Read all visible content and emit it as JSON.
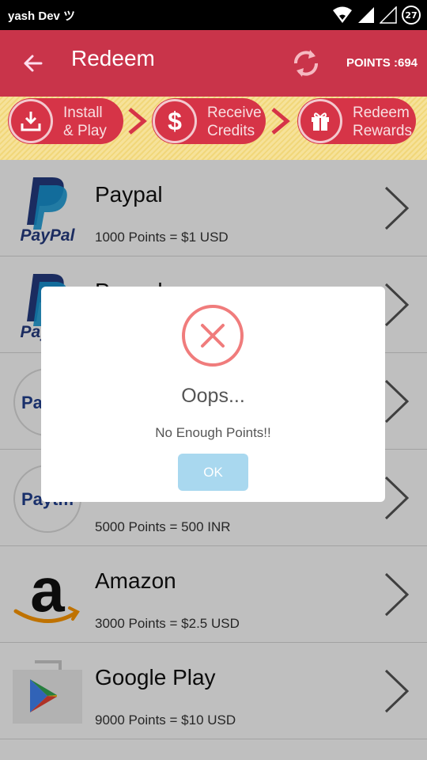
{
  "status_bar": {
    "user": "yash Dev ツ",
    "battery": "27"
  },
  "app_bar": {
    "title": "Redeem",
    "points": "POINTS :694"
  },
  "steps": [
    {
      "line1": "Install",
      "line2": "& Play",
      "icon": "download-icon"
    },
    {
      "line1": "Receive",
      "line2": "Credits",
      "icon": "dollar-icon"
    },
    {
      "line1": "Redeem",
      "line2": "Rewards",
      "icon": "gift-icon"
    }
  ],
  "list": [
    {
      "name": "Paypal",
      "points": "1000 Points = $1 USD",
      "logo": "paypal-logo",
      "logo_text": "PayPal"
    },
    {
      "name": "Paypal",
      "points": "",
      "logo": "paypal-logo",
      "logo_text": "PayPal"
    },
    {
      "name": "",
      "points": "",
      "logo": "paytm-logo",
      "logo_text": "Paytm"
    },
    {
      "name": "",
      "points": "5000 Points = 500 INR",
      "logo": "paytm-logo",
      "logo_text": "Paytm"
    },
    {
      "name": "Amazon",
      "points": "3000 Points = $2.5 USD",
      "logo": "amazon-logo",
      "logo_text": "a"
    },
    {
      "name": "Google Play",
      "points": "9000 Points = $10 USD",
      "logo": "google-play-logo",
      "logo_text": ""
    }
  ],
  "dialog": {
    "title": "Oops...",
    "message": "No Enough Points!!",
    "ok_label": "OK"
  },
  "colors": {
    "app_bar": "#c9344a",
    "step_pill": "#d63447",
    "error": "#f07c7c",
    "ok_button": "#a9d8ef"
  }
}
